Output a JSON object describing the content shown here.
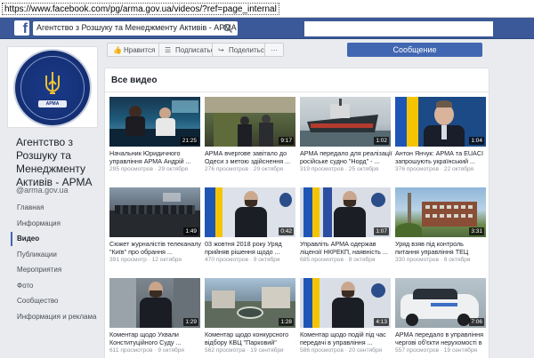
{
  "browser": {
    "url": "https://www.facebook.com/pg/arma.gov.ua/videos/?ref=page_internal"
  },
  "topbar": {
    "logo": "f",
    "search_text": "Агентство з Розшуку та Менеджменту Активів - АРМА",
    "search_icon": "search-icon"
  },
  "page": {
    "logo_text": "АРМА",
    "name": "Агентство з Розшуку та Менеджменту Активів - АРМА",
    "handle": "@arma.gov.ua"
  },
  "nav": [
    {
      "label": "Главная"
    },
    {
      "label": "Информация"
    },
    {
      "label": "Видео"
    },
    {
      "label": "Публикации"
    },
    {
      "label": "Мероприятия"
    },
    {
      "label": "Фото"
    },
    {
      "label": "Сообщество"
    },
    {
      "label": "Информация и реклама"
    }
  ],
  "actions": {
    "like": "Нравится",
    "follow": "Подписаться",
    "share": "Поделиться",
    "more": "···",
    "message": "Сообщение"
  },
  "videos_section": {
    "title": "Все видео"
  },
  "videos": [
    {
      "title": "Начальник Юридичного управління АРМА Андрій ...",
      "meta": "295 просмотров · 29 октября",
      "duration": "21:25"
    },
    {
      "title": "АРМА вчергове завітало до Одеси з метою здійснення ...",
      "meta": "276 просмотров · 29 октября",
      "duration": "9:17"
    },
    {
      "title": "АРМА передало для реалізації російське судно \"Норд\" - ...",
      "meta": "319 просмотров · 25 октября",
      "duration": "1:02"
    },
    {
      "title": "Антон Янчук: АРМА та EUACI запрошують український ...",
      "meta": "376 просмотров · 22 октября",
      "duration": "1:04"
    },
    {
      "title": "Сюжет журналістів телеканалу \"Київ\" про обрання ...",
      "meta": "391 просмотр · 12 октября",
      "duration": "1:49"
    },
    {
      "title": "03 жовтня 2018 року Уряд прийняв рішення щодо ...",
      "meta": "470 просмотров · 9 октября",
      "duration": "0:42"
    },
    {
      "title": "Управлiть АРМА одержав ліцензії НКРЕКП, наявність ...",
      "meta": "685 просмотров · 8 октября",
      "duration": "1:07"
    },
    {
      "title": "Уряд взяв під контроль питання управління ТЕЦ",
      "meta": "330 просмотров · 8 октября",
      "duration": "3:31"
    },
    {
      "title": "Коментар щодо Ухвали Конституційного Суду ...",
      "meta": "611 просмотров · 9 октября",
      "duration": "1:29"
    },
    {
      "title": "Коментар щодо конкурсного відбору КВЦ \"Парковий\"",
      "meta": "562 просмотра · 19 сентября",
      "duration": "1:28"
    },
    {
      "title": "Коментар щодо подій під час передачі в управління ...",
      "meta": "586 просмотров · 20 сентября",
      "duration": "4:13"
    },
    {
      "title": "АРМА передало в управління чергові об'єкти нерухомості в ...",
      "meta": "557 просмотров · 19 сентября",
      "duration": "7:06"
    }
  ],
  "colors": {
    "fb_blue": "#3b5998",
    "button_blue": "#4267b2",
    "bg": "#e9ebee"
  }
}
